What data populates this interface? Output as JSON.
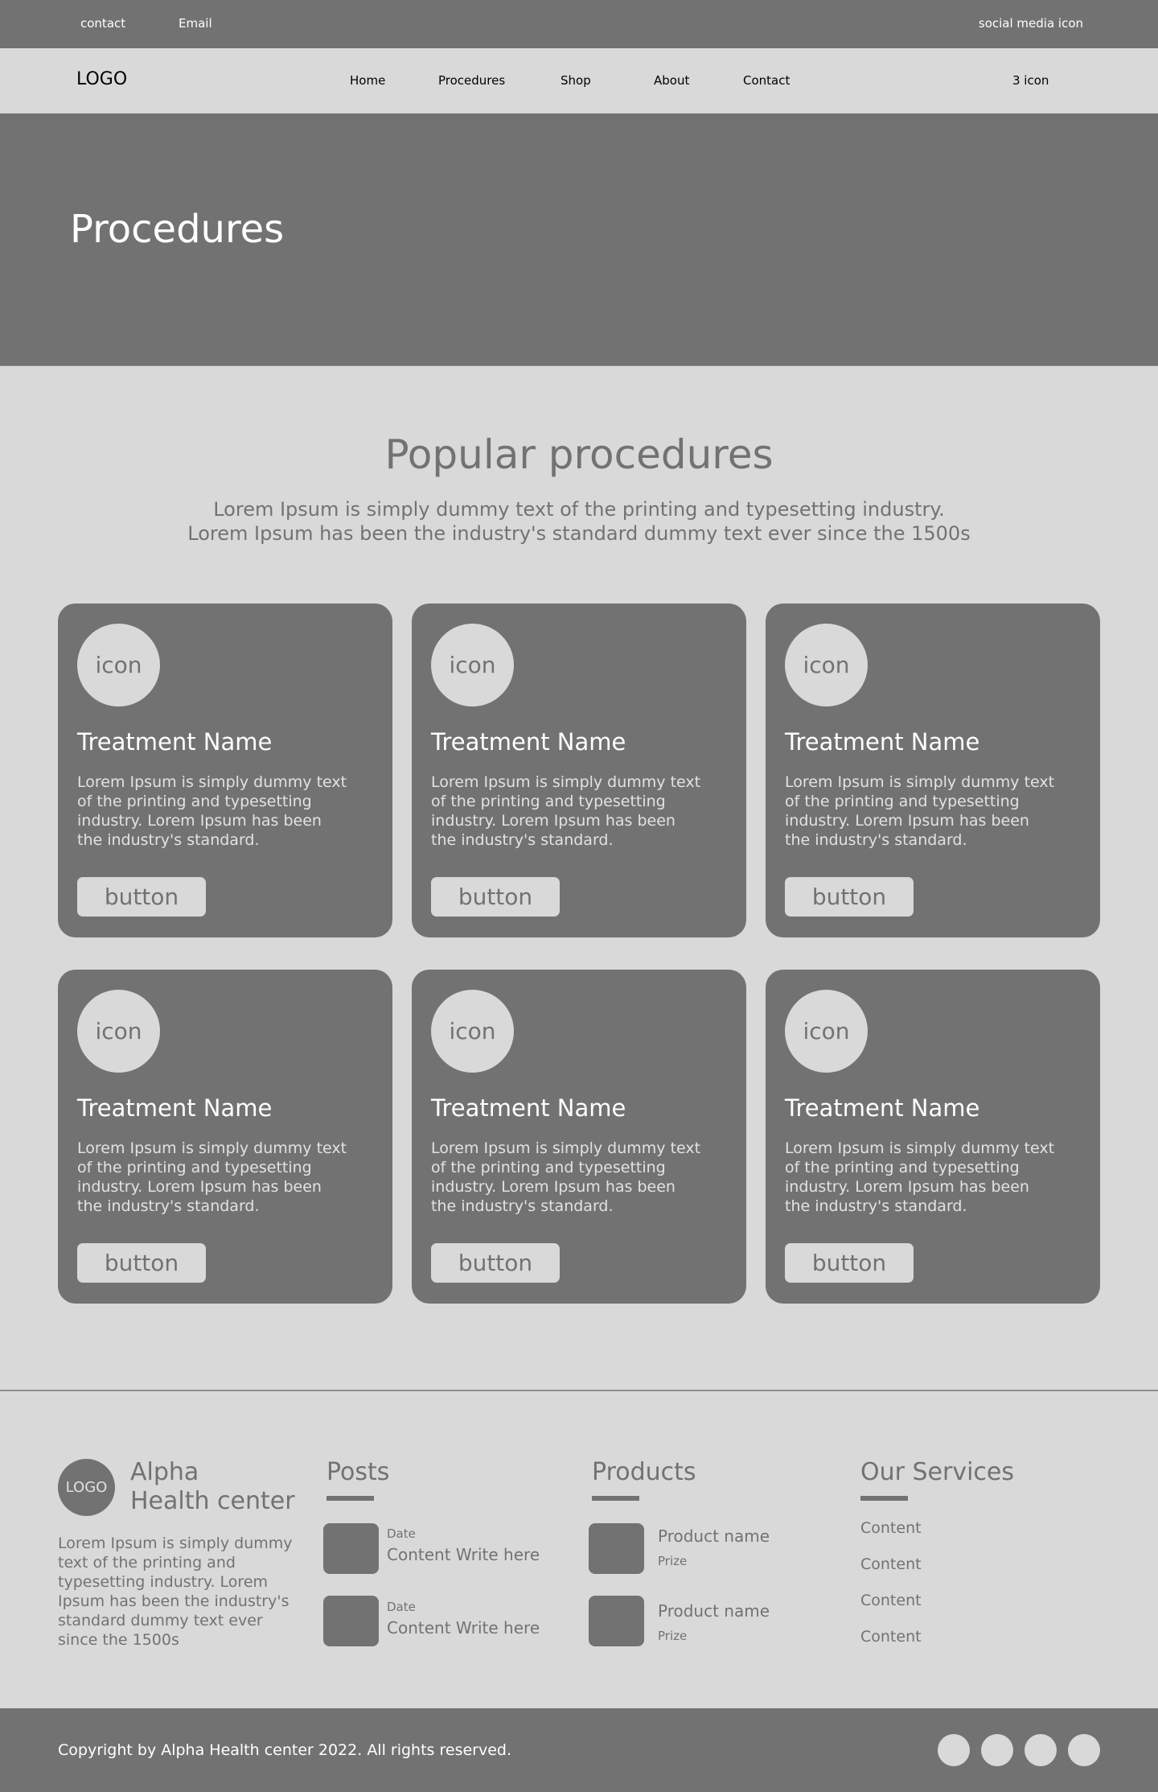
{
  "topbar": {
    "contact": "contact",
    "email": "Email",
    "social": "social media icon"
  },
  "navbar": {
    "logo": "LOGO",
    "menu": [
      "Home",
      "Procedures",
      "Shop",
      "About",
      "Contact"
    ],
    "icons": "3 icon"
  },
  "hero": {
    "title": "Procedures"
  },
  "section": {
    "title": "Popular procedures",
    "subtitle_line1": "Lorem Ipsum is simply dummy text of the printing and typesetting industry.",
    "subtitle_line2": "Lorem Ipsum has been the industry's standard dummy text ever since the 1500s"
  },
  "cards": [
    {
      "icon": "icon",
      "title": "Treatment Name",
      "text": "Lorem Ipsum is simply dummy text of the printing and typesetting industry. Lorem Ipsum has been the industry's standard.",
      "button": "button"
    },
    {
      "icon": "icon",
      "title": "Treatment Name",
      "text": "Lorem Ipsum is simply dummy text of the printing and typesetting industry. Lorem Ipsum has been the industry's standard.",
      "button": "button"
    },
    {
      "icon": "icon",
      "title": "Treatment Name",
      "text": "Lorem Ipsum is simply dummy text of the printing and typesetting industry. Lorem Ipsum has been the industry's standard.",
      "button": "button"
    },
    {
      "icon": "icon",
      "title": "Treatment Name",
      "text": "Lorem Ipsum is simply dummy text of the printing and typesetting industry. Lorem Ipsum has been the industry's standard.",
      "button": "button"
    },
    {
      "icon": "icon",
      "title": "Treatment Name",
      "text": "Lorem Ipsum is simply dummy text of the printing and typesetting industry. Lorem Ipsum has been the industry's standard.",
      "button": "button"
    },
    {
      "icon": "icon",
      "title": "Treatment Name",
      "text": "Lorem Ipsum is simply dummy text of the printing and typesetting industry. Lorem Ipsum has been the industry's standard.",
      "button": "button"
    }
  ],
  "footer": {
    "logo": "LOGO",
    "brand_line1": "Alpha",
    "brand_line2": "Health center",
    "about": "Lorem Ipsum is simply dummy text of the printing and typesetting industry. Lorem Ipsum has been the industry's standard dummy text ever since the 1500s",
    "posts": {
      "heading": "Posts",
      "items": [
        {
          "date": "Date",
          "text": "Content Write here"
        },
        {
          "date": "Date",
          "text": "Content Write here"
        }
      ]
    },
    "products": {
      "heading": "Products",
      "items": [
        {
          "name": "Product name",
          "prize": "Prize"
        },
        {
          "name": "Product name",
          "prize": "Prize"
        }
      ]
    },
    "services": {
      "heading": "Our Services",
      "items": [
        "Content",
        "Content",
        "Content",
        "Content"
      ]
    }
  },
  "bottombar": {
    "copyright": "Copyright by Alpha Health center 2022. All rights reserved.",
    "social_icons": [
      "social-icon",
      "social-icon",
      "social-icon",
      "social-icon"
    ]
  },
  "colors": {
    "dark_gray": "#727272",
    "light_gray": "#d9d9d9",
    "white": "#ffffff"
  }
}
